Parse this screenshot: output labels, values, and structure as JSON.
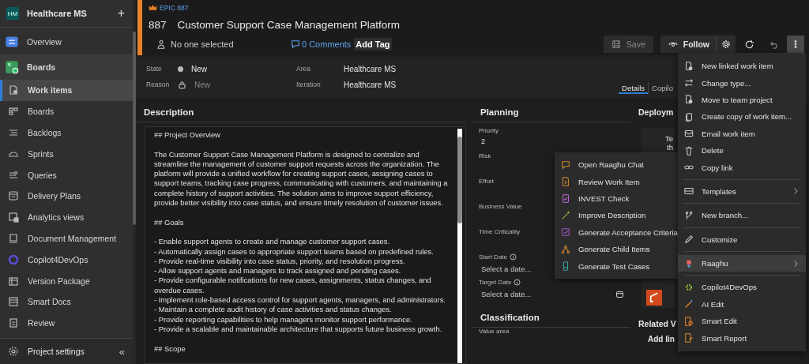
{
  "sidebar": {
    "project": {
      "initials": "HM",
      "name": "Healthcare MS",
      "add": "+"
    },
    "items": [
      {
        "label": "Overview",
        "kind": "hub",
        "selected": false
      },
      {
        "label": "Boards",
        "kind": "hub",
        "selected": false
      },
      {
        "label": "Work items",
        "kind": "page",
        "selected": true
      },
      {
        "label": "Boards",
        "kind": "page",
        "selected": false
      },
      {
        "label": "Backlogs",
        "kind": "page",
        "selected": false
      },
      {
        "label": "Sprints",
        "kind": "page",
        "selected": false
      },
      {
        "label": "Queries",
        "kind": "page",
        "selected": false
      },
      {
        "label": "Delivery Plans",
        "kind": "page",
        "selected": false
      },
      {
        "label": "Analytics views",
        "kind": "page",
        "selected": false
      },
      {
        "label": "Document Management",
        "kind": "page",
        "selected": false
      },
      {
        "label": "Copilot4DevOps",
        "kind": "page",
        "selected": false
      },
      {
        "label": "Version Package",
        "kind": "page",
        "selected": false
      },
      {
        "label": "Smart Docs",
        "kind": "page",
        "selected": false
      },
      {
        "label": "Review",
        "kind": "page",
        "selected": false
      }
    ],
    "footer": {
      "label": "Project settings",
      "collapse": "«"
    }
  },
  "work_item": {
    "type_label": "EPIC 887",
    "id": "887",
    "title": "Customer Support Case Management Platform",
    "assignee": "No one selected",
    "comments": "0 Comments",
    "add_tag": "Add Tag",
    "toolbar": [
      {
        "kind": "save",
        "label": "Save",
        "disabled": true
      },
      {
        "kind": "follow",
        "label": "Follow"
      },
      {
        "kind": "settings"
      },
      {
        "kind": "refresh"
      },
      {
        "kind": "undo"
      },
      {
        "kind": "more",
        "selected": true
      }
    ],
    "fields": [
      {
        "label": "State",
        "value": "New",
        "kind": "state"
      },
      {
        "label": "Area",
        "value": "Healthcare MS",
        "kind": "text"
      },
      {
        "label": "Reason",
        "value": "New",
        "kind": "reason"
      },
      {
        "label": "Iteration",
        "value": "Healthcare MS",
        "kind": "text"
      }
    ],
    "tabs": [
      {
        "label": "Details",
        "selected": true
      },
      {
        "label": "Copilo",
        "selected": false
      }
    ]
  },
  "description": {
    "title": "Description",
    "blocks": [
      {
        "kind": "heading",
        "text": "## Project Overview"
      },
      {
        "kind": "paragraph",
        "text": "The Customer Support Case Management Platform is designed to centralize and streamline the management of customer support requests across the organization. The platform will provide a unified workflow for creating support cases, assigning cases to support teams, tracking case progress, communicating with customers, and maintaining a complete history of support activities. The solution aims to improve support efficiency, provide better visibility into case status, and ensure timely resolution of customer issues."
      },
      {
        "kind": "heading",
        "text": "## Goals"
      },
      {
        "kind": "bullet",
        "text": "- Enable support agents to create and manage customer support cases."
      },
      {
        "kind": "bullet",
        "text": "- Automatically assign cases to appropriate support teams based on predefined rules."
      },
      {
        "kind": "bullet",
        "text": "- Provide real-time visibility into case status, priority, and resolution progress."
      },
      {
        "kind": "bullet",
        "text": "- Allow support agents and managers to track assigned and pending cases."
      },
      {
        "kind": "bullet",
        "text": "- Provide configurable notifications for new cases, assignments, status changes, and overdue cases."
      },
      {
        "kind": "bullet",
        "text": "- Implement role-based access control for support agents, managers, and administrators."
      },
      {
        "kind": "bullet",
        "text": "- Maintain a complete audit history of case activities and status changes."
      },
      {
        "kind": "bullet",
        "text": "- Provide reporting capabilities to help managers monitor support performance."
      },
      {
        "kind": "bullet",
        "text": "- Provide a scalable and maintainable architecture that supports future business growth."
      },
      {
        "kind": "heading",
        "text": "## Scope"
      }
    ]
  },
  "planning": {
    "title": "Planning",
    "fields": [
      {
        "label": "Priority",
        "value": "2",
        "kind": "value"
      },
      {
        "label": "Risk",
        "kind": "empty"
      },
      {
        "label": "Effort",
        "kind": "empty"
      },
      {
        "label": "Business Value",
        "kind": "empty"
      },
      {
        "label": "Time Criticality",
        "kind": "empty"
      },
      {
        "label": "Start Date",
        "placeholder": "Select a date...",
        "kind": "date"
      },
      {
        "label": "Target Date",
        "placeholder": "Select a date...",
        "kind": "date"
      }
    ],
    "classification": {
      "title": "Classification",
      "fields": [
        {
          "label": "Value area"
        }
      ]
    }
  },
  "right_panel": {
    "deployment_title": "Deploym",
    "card_lines": [
      "Te",
      "th"
    ],
    "related_title": "Related V",
    "add_link": "Add lin"
  },
  "ai_menu": {
    "items": [
      {
        "label": "Open Raaghu Chat"
      },
      {
        "label": "Review Work Item"
      },
      {
        "label": "INVEST Check"
      },
      {
        "label": "Improve Description"
      },
      {
        "label": "Generate Acceptance Criteria"
      },
      {
        "label": "Generate Child Items"
      },
      {
        "label": "Generate Test Cases"
      }
    ]
  },
  "more_menu": {
    "groups": [
      [
        {
          "label": "New linked work item",
          "submenu": false,
          "highlighted": false
        },
        {
          "label": "Change type...",
          "submenu": false,
          "highlighted": false
        },
        {
          "label": "Move to team project",
          "submenu": false,
          "highlighted": false
        },
        {
          "label": "Create copy of work item...",
          "submenu": false,
          "highlighted": false
        },
        {
          "label": "Email work item",
          "submenu": false,
          "highlighted": false
        },
        {
          "label": "Delete",
          "submenu": false,
          "highlighted": false
        },
        {
          "label": "Copy link",
          "submenu": false,
          "highlighted": false
        }
      ],
      [
        {
          "label": "Templates",
          "submenu": true,
          "highlighted": false
        }
      ],
      [
        {
          "label": "New branch...",
          "submenu": false,
          "highlighted": false
        }
      ],
      [
        {
          "label": "Customize",
          "submenu": false,
          "highlighted": false
        }
      ],
      [
        {
          "label": "Raaghu",
          "submenu": true,
          "highlighted": true
        }
      ],
      [
        {
          "label": "Copilot4DevOps",
          "submenu": false,
          "highlighted": false
        },
        {
          "label": "AI Edit",
          "submenu": false,
          "highlighted": false
        },
        {
          "label": "Smart Edit",
          "submenu": false,
          "highlighted": false
        },
        {
          "label": "Smart Report",
          "submenu": false,
          "highlighted": false
        }
      ]
    ]
  }
}
